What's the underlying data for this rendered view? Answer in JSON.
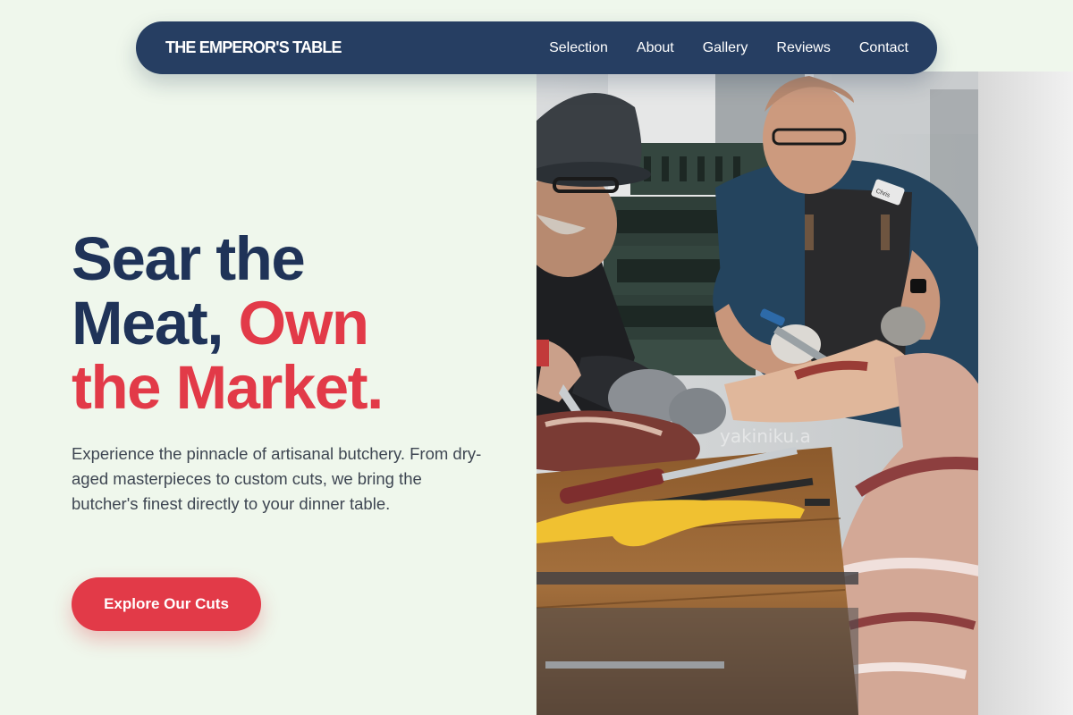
{
  "nav": {
    "brand": "THE EMPEROR'S TABLE",
    "links": [
      "Selection",
      "About",
      "Gallery",
      "Reviews",
      "Contact"
    ]
  },
  "hero": {
    "title_line1": "Sear the",
    "title_line2a": "Meat,",
    "title_line2b": "Own",
    "title_line3": "the Market.",
    "description": "Experience the pinnacle of artisanal butchery. From dry-aged masterpieces to custom cuts, we bring the butcher's finest directly to your dinner table.",
    "cta_label": "Explore Our Cuts"
  },
  "photo": {
    "watermark": "yakiniku.a",
    "badge_text": "Chris"
  },
  "colors": {
    "page_background": "#eff7ec",
    "navy": "#263e62",
    "heading_navy": "#1f3358",
    "accent_red": "#e23a48",
    "body_text": "#3e4652"
  }
}
